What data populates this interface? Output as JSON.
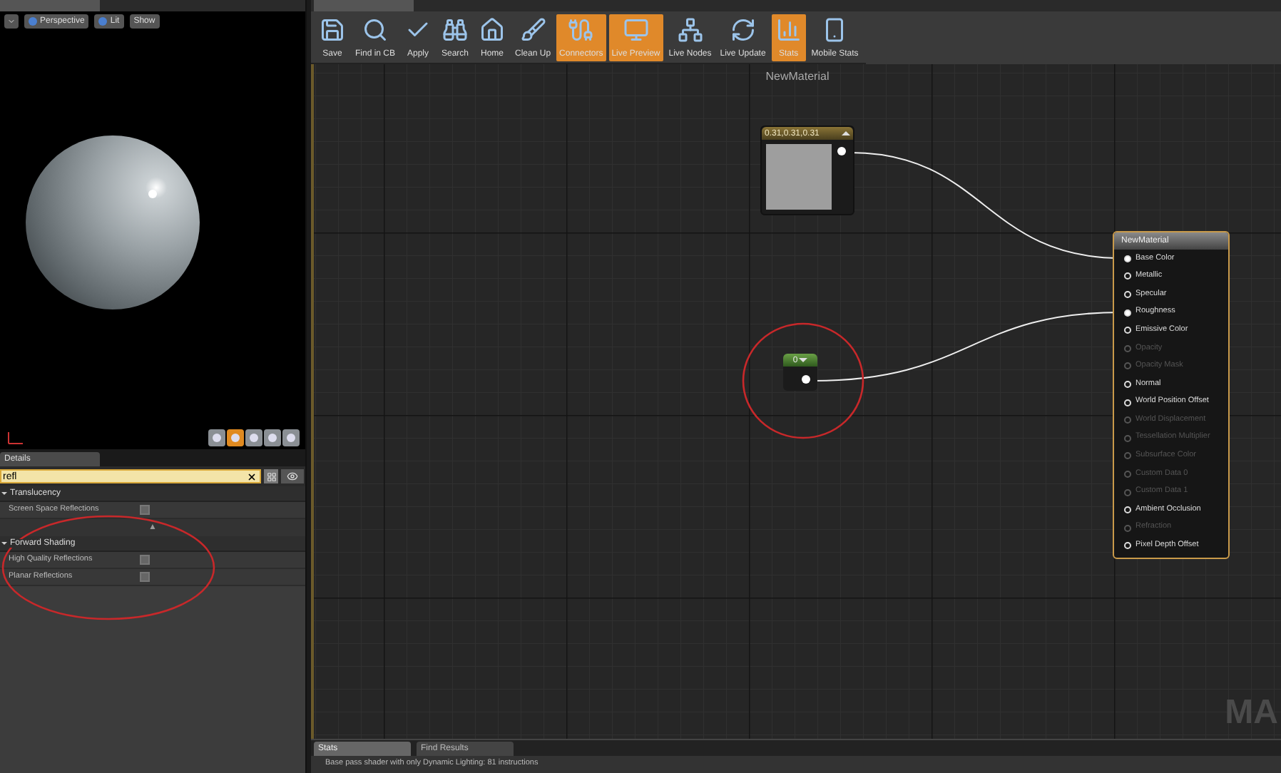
{
  "viewport": {
    "buttons": [
      {
        "label": "Perspective",
        "kind": "sphere"
      },
      {
        "label": "Lit",
        "kind": "sphere"
      },
      {
        "label": "Show",
        "kind": "plain"
      }
    ],
    "corner_buttons": [
      {
        "selected": false
      },
      {
        "selected": true
      },
      {
        "selected": false
      },
      {
        "selected": false
      },
      {
        "selected": false
      }
    ]
  },
  "details": {
    "tab": "Details",
    "search": {
      "value": "refl"
    },
    "categories": [
      {
        "title": "Translucency",
        "expanded": true,
        "properties": [
          {
            "label": "Screen Space Reflections",
            "checked": false
          }
        ],
        "advanced": "▲"
      },
      {
        "title": "Forward Shading",
        "expanded": true,
        "properties": [
          {
            "label": "High Quality Reflections",
            "checked": false
          },
          {
            "label": "Planar Reflections",
            "checked": false
          }
        ]
      }
    ]
  },
  "toolbar": [
    {
      "label": "Save",
      "selected": false
    },
    {
      "label": "Find in CB",
      "selected": false
    },
    {
      "label": "Apply",
      "selected": false
    },
    {
      "label": "Search",
      "selected": false
    },
    {
      "label": "Home",
      "selected": false
    },
    {
      "label": "Clean Up",
      "selected": false
    },
    {
      "label": "Connectors",
      "selected": true
    },
    {
      "label": "Live Preview",
      "selected": true
    },
    {
      "label": "Live Nodes",
      "selected": false
    },
    {
      "label": "Live Update",
      "selected": false
    },
    {
      "label": "Stats",
      "selected": true
    },
    {
      "label": "Mobile Stats",
      "selected": false
    }
  ],
  "graph": {
    "title": "NewMaterial",
    "corner_label": "MA",
    "vector_node": {
      "title": "0.31,0.31,0.31"
    },
    "constant_node": {
      "title": "0"
    },
    "material_node": {
      "title": "NewMaterial",
      "pins": [
        {
          "label": "Base Color",
          "connected": true,
          "disabled": false
        },
        {
          "label": "Metallic",
          "connected": false,
          "disabled": false
        },
        {
          "label": "Specular",
          "connected": false,
          "disabled": false
        },
        {
          "label": "Roughness",
          "connected": true,
          "disabled": false
        },
        {
          "label": "Emissive Color",
          "connected": false,
          "disabled": false
        },
        {
          "label": "Opacity",
          "connected": false,
          "disabled": true
        },
        {
          "label": "Opacity Mask",
          "connected": false,
          "disabled": true
        },
        {
          "label": "Normal",
          "connected": false,
          "disabled": false
        },
        {
          "label": "World Position Offset",
          "connected": false,
          "disabled": false
        },
        {
          "label": "World Displacement",
          "connected": false,
          "disabled": true
        },
        {
          "label": "Tessellation Multiplier",
          "connected": false,
          "disabled": true
        },
        {
          "label": "Subsurface Color",
          "connected": false,
          "disabled": true
        },
        {
          "label": "Custom Data 0",
          "connected": false,
          "disabled": true
        },
        {
          "label": "Custom Data 1",
          "connected": false,
          "disabled": true
        },
        {
          "label": "Ambient Occlusion",
          "connected": false,
          "disabled": false
        },
        {
          "label": "Refraction",
          "connected": false,
          "disabled": true
        },
        {
          "label": "Pixel Depth Offset",
          "connected": false,
          "disabled": false
        }
      ]
    }
  },
  "bottom_tabs": [
    {
      "label": "Stats",
      "selected": true
    },
    {
      "label": "Find Results",
      "selected": false
    }
  ],
  "status_line": "Base pass shader with only Dynamic Lighting: 81 instructions"
}
